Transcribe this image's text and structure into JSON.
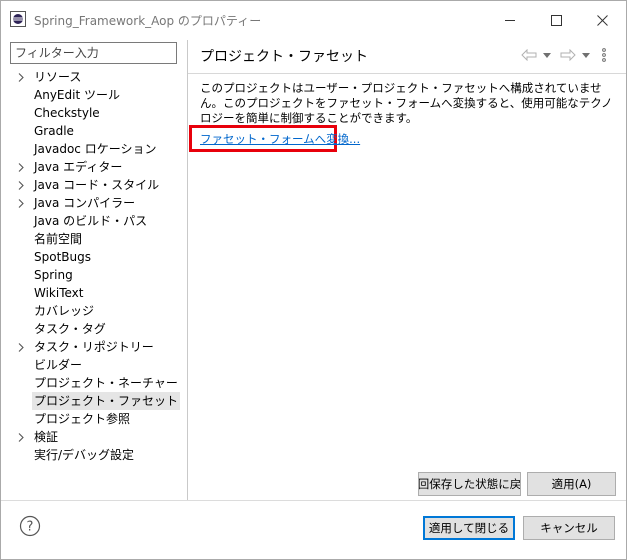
{
  "window": {
    "title": "Spring_Framework_Aop のプロパティー",
    "icons": {
      "app": "eclipse-icon",
      "minimize": "minimize-icon",
      "maximize": "maximize-icon",
      "close": "close-icon"
    }
  },
  "filter": {
    "placeholder": "フィルター入力",
    "value": ""
  },
  "tree": {
    "items": [
      {
        "label": "リソース",
        "expandable": true
      },
      {
        "label": "AnyEdit ツール",
        "expandable": false
      },
      {
        "label": "Checkstyle",
        "expandable": false
      },
      {
        "label": "Gradle",
        "expandable": false
      },
      {
        "label": "Javadoc ロケーション",
        "expandable": false
      },
      {
        "label": "Java エディター",
        "expandable": true
      },
      {
        "label": "Java コード・スタイル",
        "expandable": true
      },
      {
        "label": "Java コンパイラー",
        "expandable": true
      },
      {
        "label": "Java のビルド・パス",
        "expandable": false
      },
      {
        "label": "名前空間",
        "expandable": false
      },
      {
        "label": "SpotBugs",
        "expandable": false
      },
      {
        "label": "Spring",
        "expandable": false
      },
      {
        "label": "WikiText",
        "expandable": false
      },
      {
        "label": "カバレッジ",
        "expandable": false
      },
      {
        "label": "タスク・タグ",
        "expandable": false
      },
      {
        "label": "タスク・リポジトリー",
        "expandable": true
      },
      {
        "label": "ビルダー",
        "expandable": false
      },
      {
        "label": "プロジェクト・ネーチャー",
        "expandable": false
      },
      {
        "label": "プロジェクト・ファセット",
        "expandable": false,
        "selected": true
      },
      {
        "label": "プロジェクト参照",
        "expandable": false
      },
      {
        "label": "検証",
        "expandable": true
      },
      {
        "label": "実行/デバッグ設定",
        "expandable": false
      }
    ]
  },
  "page": {
    "title": "プロジェクト・ファセット",
    "nav_icons": [
      "back-arrow-icon",
      "back-menu-icon",
      "forward-arrow-icon",
      "forward-menu-icon",
      "view-menu-icon"
    ],
    "description": "このプロジェクトはユーザー・プロジェクト・ファセットへ構成されていません。このプロジェクトをファセット・フォームへ変換すると、使用可能なテクノロジーを簡単に制御することができます。",
    "convert_link": "ファセット・フォームへ変換...",
    "highlight_color": "#e8000b"
  },
  "buttons": {
    "restore_defaults": "回保存した状態に戻",
    "apply": "適用(A)",
    "apply_and_close": "適用して閉じる",
    "cancel": "キャンセル"
  },
  "help": {
    "icon": "help-icon"
  }
}
